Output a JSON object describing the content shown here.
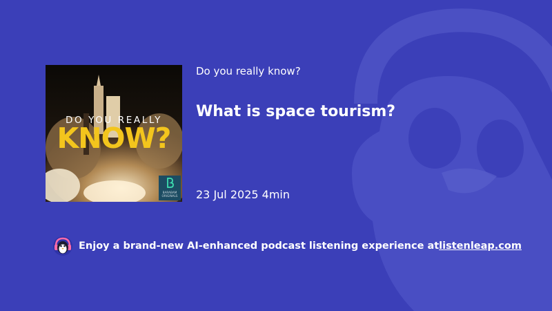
{
  "theme": {
    "background": "#3b3fb8",
    "text": "#ffffff",
    "cover_accent": "#f3c51d"
  },
  "cover": {
    "line1": "DO YOU REALLY",
    "line2": "KNOW?",
    "badge_text": "BARABAM\nORIGINALS",
    "badge_icon": "barabam-b-logo"
  },
  "podcast": {
    "show_title": "Do you really know?",
    "episode_title": "What is space tourism?",
    "date": "23 Jul 2025",
    "duration": "4min"
  },
  "promo": {
    "icon": "penguin-headphones-icon",
    "text": "Enjoy a brand-new AI-enhanced podcast listening experience at ",
    "link_text": "listenleap.com"
  }
}
